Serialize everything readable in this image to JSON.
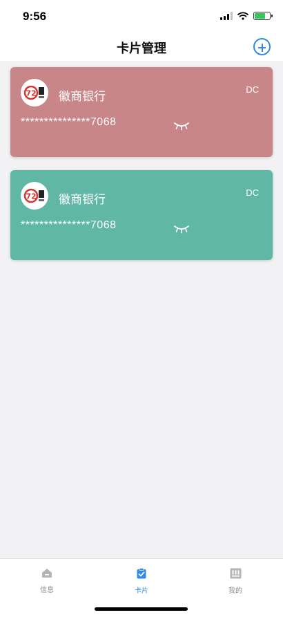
{
  "status_bar": {
    "time": "9:56"
  },
  "nav": {
    "title": "卡片管理",
    "add_icon": "plus-circle-icon"
  },
  "colors": {
    "accent": "#2f8ae8",
    "card_red": "#c98689",
    "card_teal": "#60b7a6",
    "battery": "#34c759"
  },
  "cards": [
    {
      "bank_name": "徽商银行",
      "card_type": "DC",
      "card_number": "***************7068",
      "logo_icon": "huishang-bank-logo-icon",
      "eye_icon": "eye-closed-icon"
    },
    {
      "bank_name": "徽商银行",
      "card_type": "DC",
      "card_number": "***************7068",
      "logo_icon": "huishang-bank-logo-icon",
      "eye_icon": "eye-closed-icon"
    }
  ],
  "tabs": [
    {
      "label": "信息",
      "icon": "home-icon",
      "active": false
    },
    {
      "label": "卡片",
      "icon": "card-clipboard-icon",
      "active": true
    },
    {
      "label": "我的",
      "icon": "profile-icon",
      "active": false
    }
  ]
}
